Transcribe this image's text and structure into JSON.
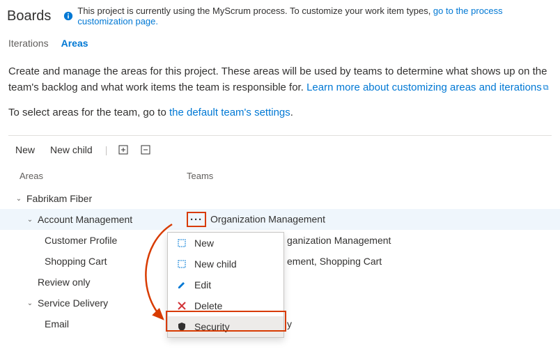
{
  "page_title": "Boards",
  "info_banner": {
    "text_before": "This project is currently using the MyScrum process. To customize your work item types, ",
    "link_text": "go to the process customization page.",
    "text_after": ""
  },
  "tabs": {
    "iterations": "Iterations",
    "areas": "Areas"
  },
  "description": {
    "line1": "Create and manage the areas for this project. These areas will be used by teams to determine what shows up on the team's backlog and what work items the team is responsible for. ",
    "link1": "Learn more about customizing areas and iterations"
  },
  "select_line": {
    "before": "To select areas for the team, go to ",
    "link": "the default team's settings",
    "after": "."
  },
  "toolbar": {
    "new": "New",
    "new_child": "New child"
  },
  "columns": {
    "areas": "Areas",
    "teams": "Teams"
  },
  "tree": {
    "root": {
      "name": "Fabrikam Fiber",
      "teams": ""
    },
    "account_mgmt": {
      "name": "Account Management",
      "teams": "Organization Management"
    },
    "customer_profile": {
      "name": "Customer Profile",
      "teams": "ganization Management"
    },
    "shopping_cart": {
      "name": "Shopping Cart",
      "teams": "ement, Shopping Cart"
    },
    "review_only": {
      "name": "Review only",
      "teams": ""
    },
    "service_delivery": {
      "name": "Service Delivery",
      "teams": ""
    },
    "email": {
      "name": "Email",
      "teams": "y"
    }
  },
  "context_menu": {
    "new": "New",
    "new_child": "New child",
    "edit": "Edit",
    "delete": "Delete",
    "security": "Security"
  }
}
